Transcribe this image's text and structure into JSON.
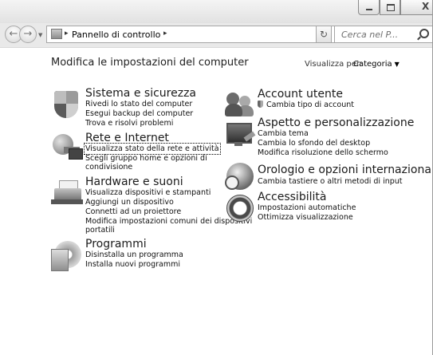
{
  "window": {
    "caption_buttons": {
      "close_glyph": "X"
    }
  },
  "address": {
    "breadcrumb": "Pannello di controllo",
    "search_placeholder": "Cerca nel P..."
  },
  "content": {
    "heading": "Modifica le impostazioni del computer",
    "view_by_label": "Visualizza per:",
    "view_by_value": "Categoria"
  },
  "left_column": [
    {
      "title": "Sistema e sicurezza",
      "icon": "shield-icon",
      "links": [
        "Rivedi lo stato del computer",
        "Esegui backup del computer",
        "Trova e risolvi problemi"
      ]
    },
    {
      "title": "Rete e Internet",
      "icon": "network-globe-icon",
      "links": [
        "Visualizza stato della rete e attività",
        "Scegli gruppo home e opzioni di",
        "condivisione"
      ]
    },
    {
      "title": "Hardware e suoni",
      "icon": "printer-icon",
      "links": [
        "Visualizza dispositivi e stampanti",
        "Aggiungi un dispositivo",
        "Connetti ad un proiettore",
        "Modifica impostazioni comuni dei dispositivi",
        "portatili"
      ]
    },
    {
      "title": "Programmi",
      "icon": "programs-disc-icon",
      "links": [
        "Disinstalla un programma",
        "Installa nuovi programmi"
      ]
    }
  ],
  "right_column": [
    {
      "title": "Account utente",
      "icon": "users-icon",
      "links": [
        "Cambia tipo di account"
      ]
    },
    {
      "title": "Aspetto e personalizzazione",
      "icon": "display-brush-icon",
      "links": [
        "Cambia tema",
        "Cambia lo sfondo del desktop",
        "Modifica risoluzione dello schermo"
      ]
    },
    {
      "title": "Orologio e opzioni internazionali",
      "icon": "globe-clock-icon",
      "links": [
        "Cambia tastiere o altri metodi di input"
      ]
    },
    {
      "title": "Accessibilità",
      "icon": "accessibility-icon",
      "links": [
        "Impostazioni automatiche",
        "Ottimizza visualizzazione"
      ]
    }
  ]
}
